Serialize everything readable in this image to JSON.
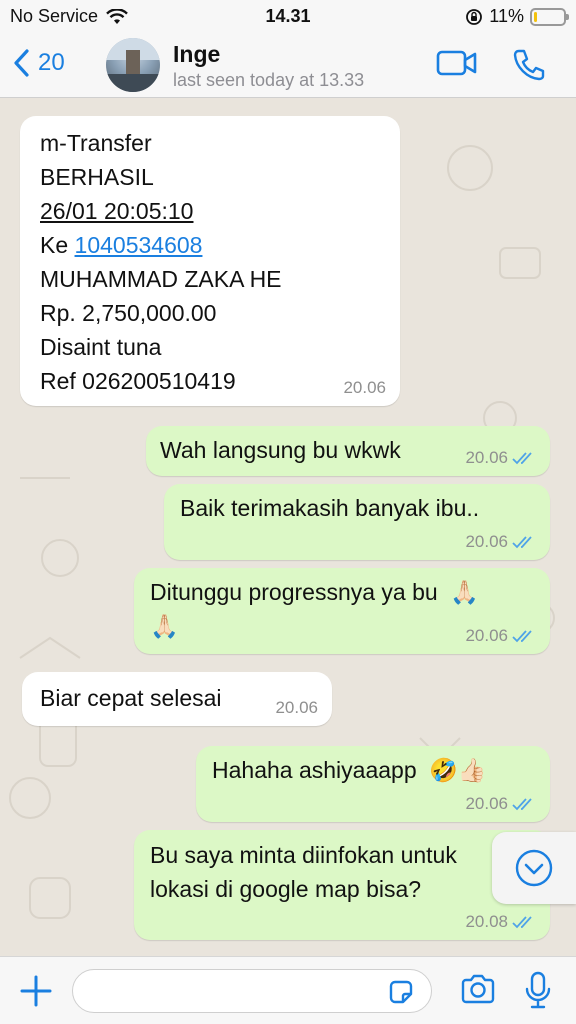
{
  "status_bar": {
    "carrier": "No Service",
    "time": "14.31",
    "battery_percent": "11%",
    "battery_level": 0.11
  },
  "header": {
    "back_count": "20",
    "contact_name": "Inge",
    "last_seen": "last seen today at 13.33"
  },
  "messages": [
    {
      "direction": "incoming",
      "lines": [
        "m-Transfer",
        "BERHASIL",
        "26/01 20:05:10",
        "Ke ",
        "MUHAMMAD ZAKA HE",
        "Rp. 2,750,000.00",
        "Disaint tuna",
        "Ref 026200510419"
      ],
      "link_text": "1040534608",
      "time": "20.06"
    },
    {
      "direction": "outgoing",
      "text": "Wah langsung bu wkwk",
      "time": "20.06"
    },
    {
      "direction": "outgoing",
      "text": "Baik terimakasih banyak ibu..",
      "time": "20.06"
    },
    {
      "direction": "outgoing",
      "text": "Ditunggu progressnya ya bu",
      "emoji": "🙏🏻",
      "time": "20.06"
    },
    {
      "direction": "incoming",
      "text": "Biar cepat selesai",
      "time": "20.06"
    },
    {
      "direction": "outgoing",
      "text": "Hahaha ashiyaaapp",
      "emoji": "🤣👍🏻",
      "time": "20.06"
    },
    {
      "direction": "outgoing",
      "lines": [
        "Bu saya minta diinfokan untuk",
        "lokasi di google map bisa?"
      ],
      "time": "20.08"
    }
  ],
  "input": {
    "placeholder": ""
  },
  "colors": {
    "accent": "#1a7fe0",
    "outgoing_bubble": "#dcf8c6",
    "incoming_bubble": "#ffffff",
    "chat_background": "#e9e4dc"
  }
}
